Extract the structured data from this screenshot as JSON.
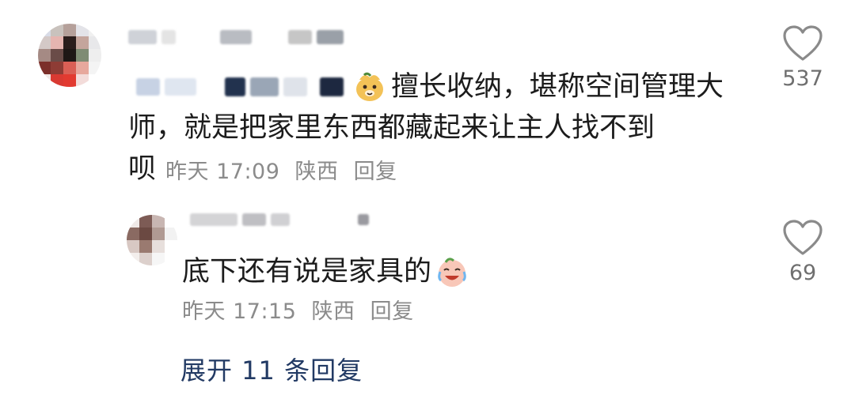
{
  "comments": [
    {
      "text_line1": "擅长收纳，堪称空间管理大",
      "text_line2": "师，就是把家里东西都藏起来让主人找不到",
      "text_line3": "呗",
      "time": "昨天 17:09",
      "location": "陕西",
      "reply_label": "回复",
      "like_count": "537",
      "emoji": "cute-bear-emoji"
    },
    {
      "text": "底下还有说是家具的",
      "time": "昨天 17:15",
      "location": "陕西",
      "reply_label": "回复",
      "like_count": "69",
      "emoji": "crying-laughing-emoji"
    }
  ],
  "expand_label": "展开 11 条回复",
  "colors": {
    "text": "#1c1c1c",
    "meta": "#8b8b8b",
    "link": "#223a64",
    "icon": "#8a8a8a"
  }
}
